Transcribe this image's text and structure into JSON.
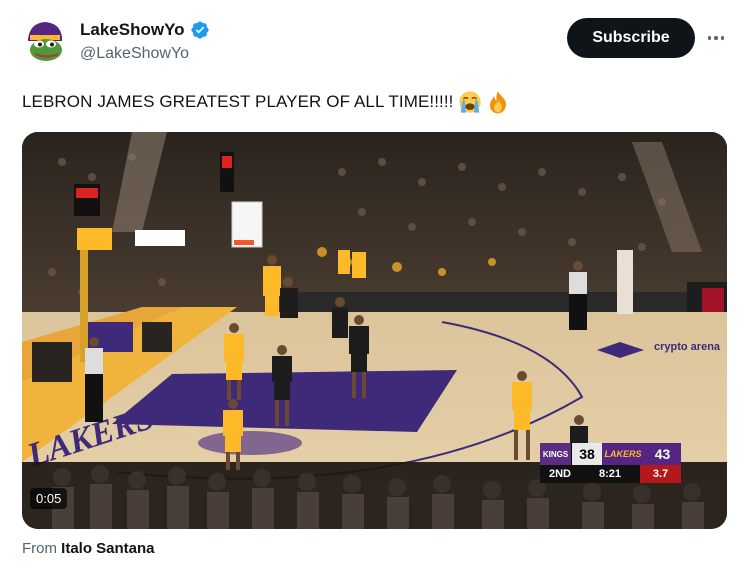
{
  "author": {
    "display_name": "LakeShowYo",
    "handle": "@LakeShowYo",
    "verified": true,
    "avatar_icon": "pepe-frog-lakers-hat-avatar"
  },
  "actions": {
    "subscribe_label": "Subscribe",
    "more_icon": "more-horizontal-icon"
  },
  "tweet": {
    "text": "LEBRON JAMES GREATEST PLAYER OF ALL TIME!!!!!",
    "emojis": [
      "loudly-crying-face",
      "fire"
    ]
  },
  "media": {
    "duration": "0:05",
    "scoreboard": {
      "away_team": "KINGS",
      "away_score": "38",
      "home_team": "LAKERS",
      "home_score": "43",
      "period": "2ND",
      "clock": "8:21",
      "shot_clock": "3.7"
    },
    "arena_text": "crypto arena",
    "baseline_text": "LAKERS"
  },
  "attribution": {
    "prefix": "From",
    "source_name": "Italo Santana"
  },
  "colors": {
    "subscribe_bg": "#0f1419",
    "verified_blue": "#1d9bf0",
    "lakers_purple": "#552583",
    "lakers_gold": "#fdb927",
    "muted_text": "#536471"
  }
}
